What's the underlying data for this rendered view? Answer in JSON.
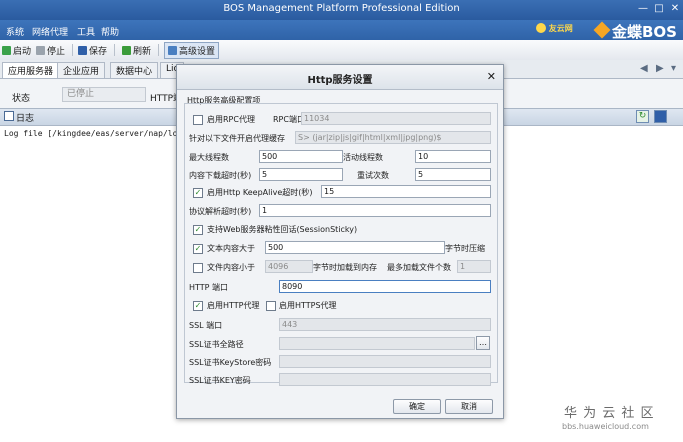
{
  "window": {
    "title": "BOS Management Platform Professional Edition"
  },
  "menu": [
    "系统",
    "网络代理",
    "工具",
    "帮助"
  ],
  "brand": {
    "kingdee_cloud": "友云网",
    "logo_text": "金蝶BOS"
  },
  "toolbar": {
    "start": "启动",
    "stop": "停止",
    "save": "保存",
    "refresh": "刷新",
    "advanced": "高级设置"
  },
  "tabs": [
    "应用服务器",
    "企业应用",
    "数据中心",
    "Lic"
  ],
  "status": {
    "label": "状态",
    "value": "已停止",
    "http_label": "HTTP端"
  },
  "log": {
    "title": "日志",
    "text": "Log file [/kingdee/eas/server/nap/logs/n"
  },
  "dialog": {
    "title": "Http服务设置",
    "group_title": "Http服务高级配置项",
    "enable_rpc": "启用RPC代理",
    "rpc_port_label": "RPC端口",
    "rpc_port_value": "11034",
    "cache_label": "针对以下文件开启代理缓存",
    "cache_value": "S> (jar|zip|js|gif|html|xml|jpg|png)$",
    "max_threads_label": "最大线程数",
    "max_threads_value": "500",
    "active_threads_label": "活动线程数",
    "active_threads_value": "10",
    "download_timeout_label": "内容下载超时(秒)",
    "download_timeout_value": "5",
    "retry_label": "重试次数",
    "retry_value": "5",
    "keepalive_label": "启用Http KeepAlive超时(秒)",
    "keepalive_value": "15",
    "protocol_timeout_label": "协议解析超时(秒)",
    "protocol_timeout_value": "1",
    "session_sticky_label": "支持Web服务器粘性回话(SessionSticky)",
    "compress_gt_label": "文本内容大于",
    "compress_gt_value": "500",
    "compress_gt_suffix": "字节时压缩",
    "memory_lt_label": "文件内容小于",
    "memory_lt_value": "4096",
    "memory_lt_suffix": "字节时加载到内存",
    "max_files_label": "最多加载文件个数",
    "max_files_value": "1",
    "http_port_label": "HTTP 端口",
    "http_port_value": "8090",
    "enable_http_proxy": "启用HTTP代理",
    "enable_https_proxy": "启用HTTPS代理",
    "ssl_port_label": "SSL 端口",
    "ssl_port_value": "443",
    "ssl_cert_path_label": "SSL证书全路径",
    "ssl_keystore_label": "SSL证书KeyStore密码",
    "ssl_key_label": "SSL证书KEY密码",
    "ok": "确定",
    "cancel": "取消"
  },
  "watermark": {
    "line1": "华 为 云 社 区",
    "line2": "bbs.huaweicloud.com"
  },
  "colors": {
    "titlebar": "#2f63a8",
    "accent": "#4a7fc1",
    "check": "#2d8a2d"
  }
}
